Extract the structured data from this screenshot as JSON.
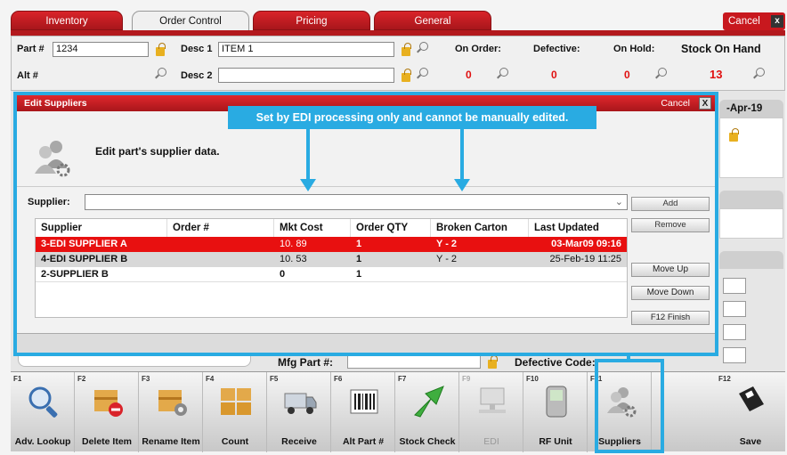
{
  "tabs": [
    "Inventory",
    "Order Control",
    "Pricing",
    "General"
  ],
  "top_cancel": "Cancel",
  "close_glyph": "x",
  "part": {
    "part_label": "Part #",
    "part_value": "1234",
    "alt_label": "Alt #",
    "desc1_label": "Desc 1",
    "desc1_value": "ITEM 1",
    "desc2_label": "Desc 2",
    "desc2_value": ""
  },
  "stock": {
    "on_order_label": "On Order:",
    "on_order": "0",
    "defective_label": "Defective:",
    "defective": "0",
    "on_hold_label": "On Hold:",
    "on_hold": "0",
    "soh_label": "Stock On Hand",
    "soh": "13"
  },
  "background": {
    "date_fragment": "-Apr-19",
    "mfg_label": "Mfg Part #:",
    "defective_code_label": "Defective Code:"
  },
  "modal": {
    "title": "Edit Suppliers",
    "cancel": "Cancel",
    "close": "X",
    "tooltip": "Set by EDI processing only and cannot be manually edited.",
    "heading": "Edit part's supplier data.",
    "supplier_label": "Supplier:",
    "supplier_value": "",
    "dropdown_glyph": "⌄",
    "columns": [
      "Supplier",
      "Order #",
      "Mkt Cost",
      "Order QTY",
      "Broken Carton",
      "Last Updated"
    ],
    "rows": [
      [
        "3-EDI SUPPLIER A",
        "",
        "10. 89",
        "1",
        "Y - 2",
        "03-Mar09 09:16"
      ],
      [
        "4-EDI SUPPLIER B",
        "",
        "10. 53",
        "1",
        "Y - 2",
        "25-Feb-19 11:25"
      ],
      [
        "2-SUPPLIER B",
        "",
        "0",
        "1",
        "",
        ""
      ]
    ],
    "buttons": [
      "Add",
      "Remove",
      "Move Up",
      "Move Down",
      "F12 Finish"
    ]
  },
  "toolbar": [
    {
      "key": "F1",
      "label": "Adv. Lookup",
      "icon": "magnifier-icon"
    },
    {
      "key": "F2",
      "label": "Delete Item",
      "icon": "delete-item-icon"
    },
    {
      "key": "F3",
      "label": "Rename Item",
      "icon": "rename-item-icon"
    },
    {
      "key": "F4",
      "label": "Count",
      "icon": "boxes-icon"
    },
    {
      "key": "F5",
      "label": "Receive",
      "icon": "truck-icon"
    },
    {
      "key": "F6",
      "label": "Alt Part #",
      "icon": "barcode-icon"
    },
    {
      "key": "F7",
      "label": "Stock Check",
      "icon": "arrow-icon"
    },
    {
      "key": "F9",
      "label": "EDI",
      "icon": "network-icon"
    },
    {
      "key": "F10",
      "label": "RF Unit",
      "icon": "handheld-icon"
    },
    {
      "key": "F11",
      "label": "Suppliers",
      "icon": "suppliers-icon"
    },
    {
      "key": "F12",
      "label": "Save",
      "icon": "floppy-disk-icon"
    }
  ],
  "colors": {
    "accent": "#29abe2",
    "brand_red": "#c8181e",
    "selected_row": "#e81010"
  }
}
